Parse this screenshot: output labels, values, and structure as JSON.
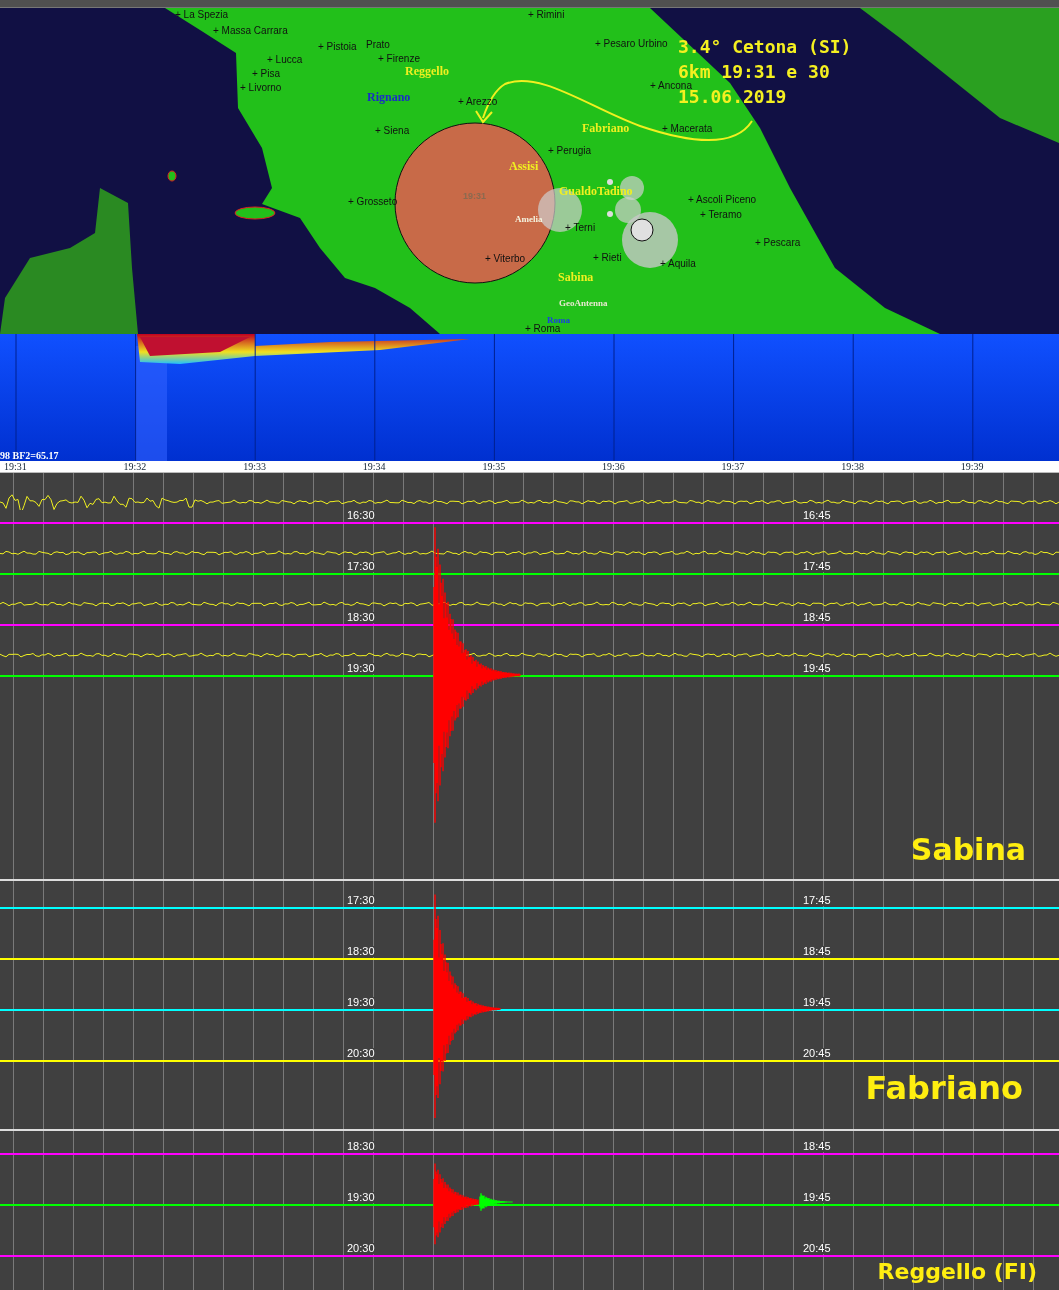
{
  "map": {
    "cities": [
      "+ Rimini",
      "+ La Spezia",
      "+ Massa Carrara",
      "+ Pistoia",
      "Prato",
      "+ Pesaro Urbino",
      "+ Firenze",
      "+ Lucca",
      "+ Pisa",
      "+ Ancona",
      "+ Livorno",
      "+ Arezzo",
      "+ Macerata",
      "+ Siena",
      "+ Perugia",
      "+ Ascoli Piceno",
      "+ Grosseto",
      "+ Teramo",
      "+ Terni",
      "+ Pescara",
      "+ Rieti",
      "+ Viterbo",
      "+ Aquila",
      "+ Roma"
    ],
    "stations": [
      {
        "name": "Reggello",
        "color": "#f0f020"
      },
      {
        "name": "Rignano",
        "color": "#1a2cc8"
      },
      {
        "name": "Fabriano",
        "color": "#f0f020"
      },
      {
        "name": "Assisi",
        "color": "#f0f020"
      },
      {
        "name": "GualdoTadino",
        "color": "#f0f020"
      },
      {
        "name": "Amelia",
        "color": "#f4f4e0"
      },
      {
        "name": "Sabina",
        "color": "#f0f020"
      },
      {
        "name": "GeoAntenna",
        "color": "#e8e8d0"
      },
      {
        "name": "Roma",
        "color": "#1a40e0"
      }
    ],
    "epicenter_time": "19:31",
    "event": [
      "3.4° Cetona (SI)",
      "6km 19:31 e 30",
      "15.06.2019"
    ]
  },
  "spectrogram": {
    "label": "98 BF2=65.17",
    "ticks": [
      "19:31",
      "19:32",
      "19:33",
      "19:34",
      "19:35",
      "19:36",
      "19:37",
      "19:38",
      "19:39"
    ]
  },
  "panels": [
    {
      "name": "Sabina",
      "rows": [
        {
          "kind": "wiggle",
          "color": "#f0f020"
        },
        {
          "kind": "line",
          "color": "#ff00ff",
          "left": "16:30",
          "right": "16:45"
        },
        {
          "kind": "wiggle",
          "color": "#f0f020"
        },
        {
          "kind": "line",
          "color": "#00ff00",
          "left": "17:30",
          "right": "17:45"
        },
        {
          "kind": "wiggle",
          "color": "#f0f020"
        },
        {
          "kind": "line",
          "color": "#ff00ff",
          "left": "18:30",
          "right": "18:45"
        },
        {
          "kind": "wiggle",
          "color": "#f0f020"
        },
        {
          "kind": "line",
          "color": "#00ff00",
          "left": "19:30",
          "right": "19:45"
        }
      ]
    },
    {
      "name": "Fabriano",
      "rows": [
        {
          "kind": "line",
          "color": "#00ffff",
          "left": "17:30",
          "right": "17:45"
        },
        {
          "kind": "line",
          "color": "#ffff00",
          "left": "18:30",
          "right": "18:45"
        },
        {
          "kind": "line",
          "color": "#00ffff",
          "left": "19:30",
          "right": "19:45"
        },
        {
          "kind": "line",
          "color": "#ffff00",
          "left": "20:30",
          "right": "20:45"
        }
      ]
    },
    {
      "name": "Reggello (FI)",
      "rows": [
        {
          "kind": "line",
          "color": "#ff00ff",
          "left": "18:30",
          "right": "18:45"
        },
        {
          "kind": "line",
          "color": "#00ff00",
          "left": "19:30",
          "right": "19:45"
        },
        {
          "kind": "line",
          "color": "#ff00ff",
          "left": "20:30",
          "right": "20:45"
        }
      ]
    }
  ]
}
